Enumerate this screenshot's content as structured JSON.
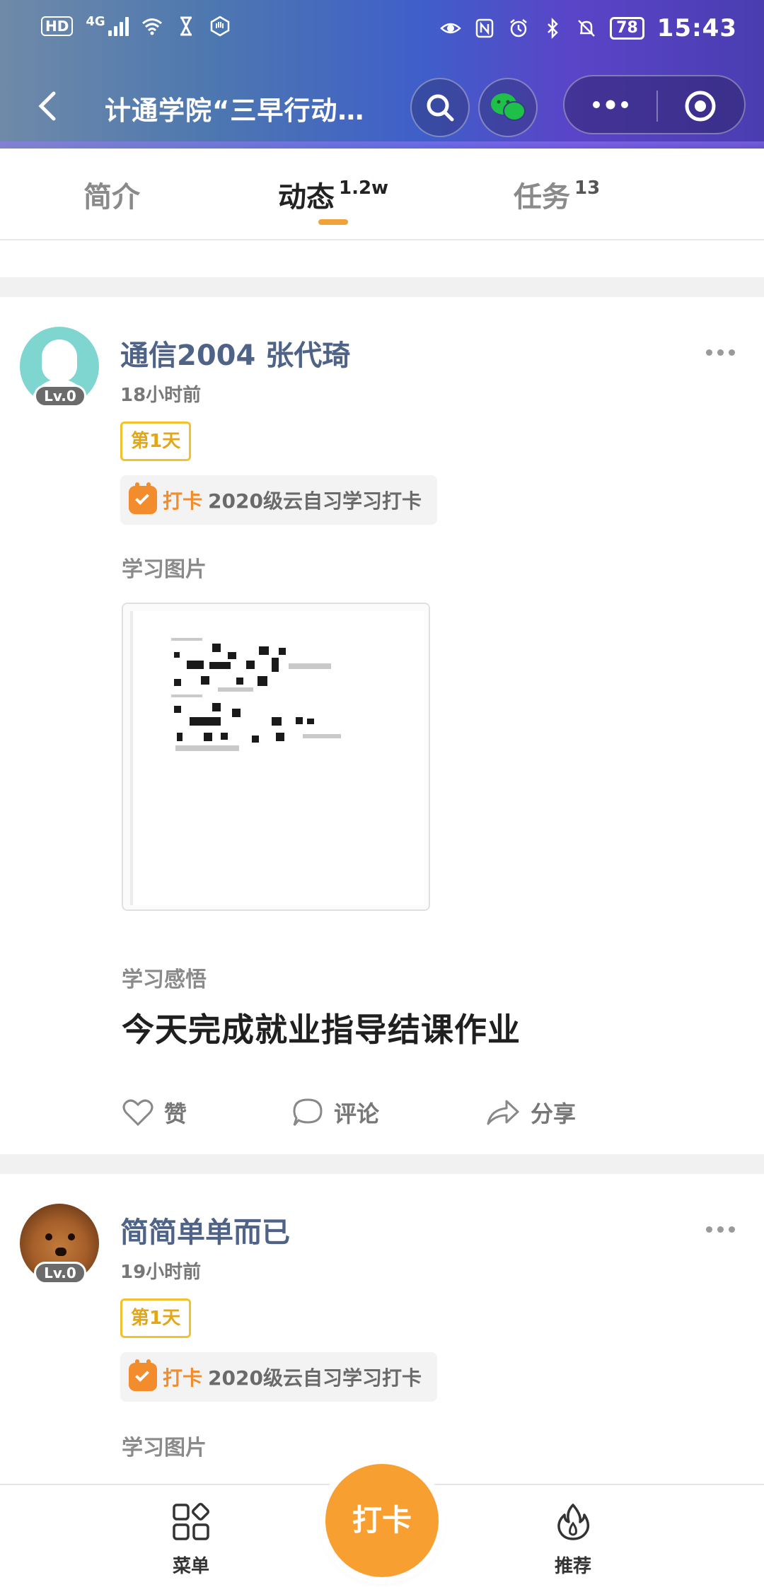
{
  "statusbar": {
    "hd": "HD",
    "network": "4G",
    "battery": "78",
    "time": "15:43"
  },
  "nav": {
    "title": "计通学院“三早行动…"
  },
  "tabs": [
    {
      "label": "简介",
      "count": ""
    },
    {
      "label": "动态",
      "count": "1.2w"
    },
    {
      "label": "任务",
      "count": "13"
    }
  ],
  "accent_color": "#f0a23b",
  "posts": [
    {
      "user": "通信2004 张代琦",
      "level": "Lv.0",
      "time": "18小时前",
      "day_badge": "第1天",
      "checkin_tag": "打卡",
      "checkin_name": "2020级云自习学习打卡",
      "images_label": "学习图片",
      "reflection_label": "学习感悟",
      "reflection": "今天完成就业指导结课作业",
      "like": "赞",
      "comment": "评论",
      "share": "分享"
    },
    {
      "user": "简简单单而已",
      "level": "Lv.0",
      "time": "19小时前",
      "day_badge": "第1天",
      "checkin_tag": "打卡",
      "checkin_name": "2020级云自习学习打卡",
      "images_label": "学习图片"
    }
  ],
  "bottomnav": {
    "menu": "菜单",
    "checkin": "打卡",
    "recommend": "推荐"
  }
}
